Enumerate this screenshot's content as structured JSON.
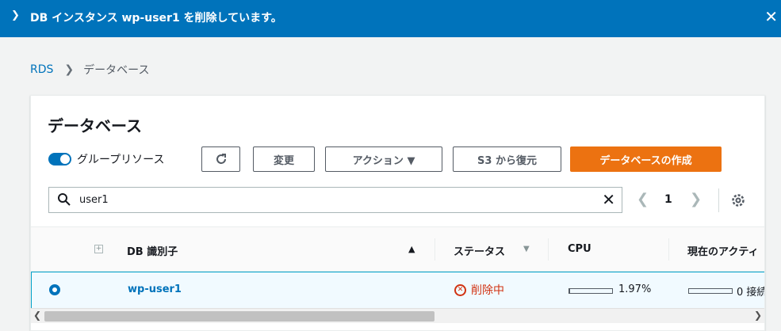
{
  "flash": {
    "message": "DB インスタンス wp-user1 を削除しています。"
  },
  "breadcrumb": {
    "root": "RDS",
    "current": "データベース"
  },
  "panel": {
    "title": "データベース",
    "group_toggle_label": "グループリソース",
    "group_toggle_on": true,
    "buttons": {
      "modify": "変更",
      "actions": "アクション ▼",
      "restore": "S3 から復元",
      "create": "データベースの作成"
    },
    "search": {
      "value": "user1"
    },
    "pagination": {
      "current_page": "1"
    }
  },
  "table": {
    "columns": {
      "db_id": "DB 識別子",
      "status": "ステータス",
      "cpu": "CPU",
      "activity": "現在のアクティ"
    },
    "rows": [
      {
        "db_id": "wp-user1",
        "status": "削除中",
        "cpu": "1.97%",
        "cpu_fraction": 0.0197,
        "connections": "0 接続"
      }
    ]
  },
  "colors": {
    "accent": "#0073bb",
    "primary_button": "#ec7211",
    "status_error": "#d13212"
  }
}
